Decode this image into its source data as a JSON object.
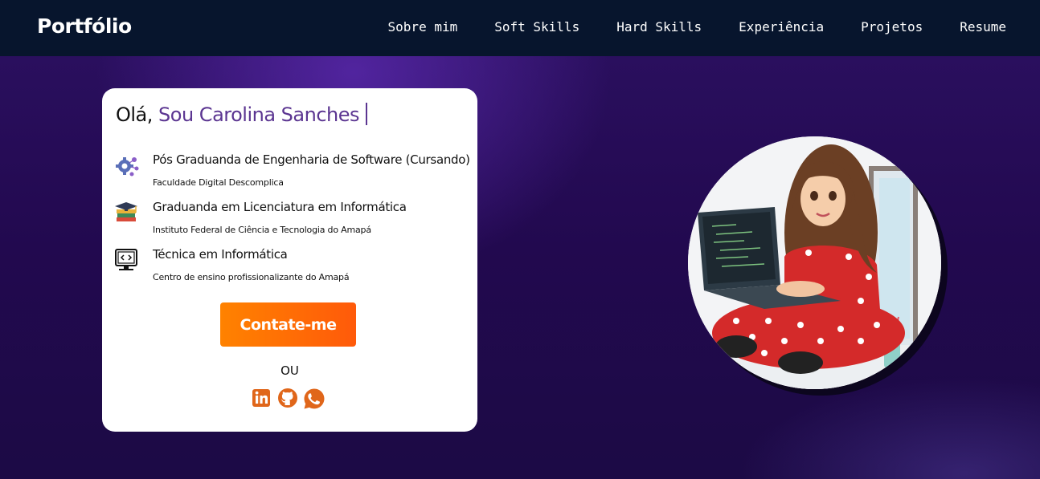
{
  "nav": {
    "brand": "Portfólio",
    "links": [
      "Sobre mim",
      "Soft Skills",
      "Hard Skills",
      "Experiência",
      "Projetos",
      "Resume"
    ]
  },
  "hero": {
    "greeting_prefix": "Olá,",
    "name": "Sou Carolina Sanches",
    "education": [
      {
        "title": "Pós Graduanda de Engenharia de Software (Cursando)",
        "institution": "Faculdade Digital Descomplica",
        "icon": "gear-network-icon"
      },
      {
        "title": "Graduanda em Licenciatura em Informática",
        "institution": "Instituto Federal de Ciência e Tecnologia do Amapá",
        "icon": "graduation-books-icon"
      },
      {
        "title": "Técnica em Informática",
        "institution": "Centro de ensino profissionalizante do Amapá",
        "icon": "code-monitor-icon"
      }
    ],
    "contact_button": "Contate-me",
    "or_label": "OU",
    "social": [
      "linkedin-icon",
      "github-icon",
      "whatsapp-icon"
    ]
  },
  "colors": {
    "nav_bg": "#07152d",
    "accent_purple": "#5b3591",
    "button_orange": "#ff6a00",
    "social_orange": "#e0661a"
  }
}
